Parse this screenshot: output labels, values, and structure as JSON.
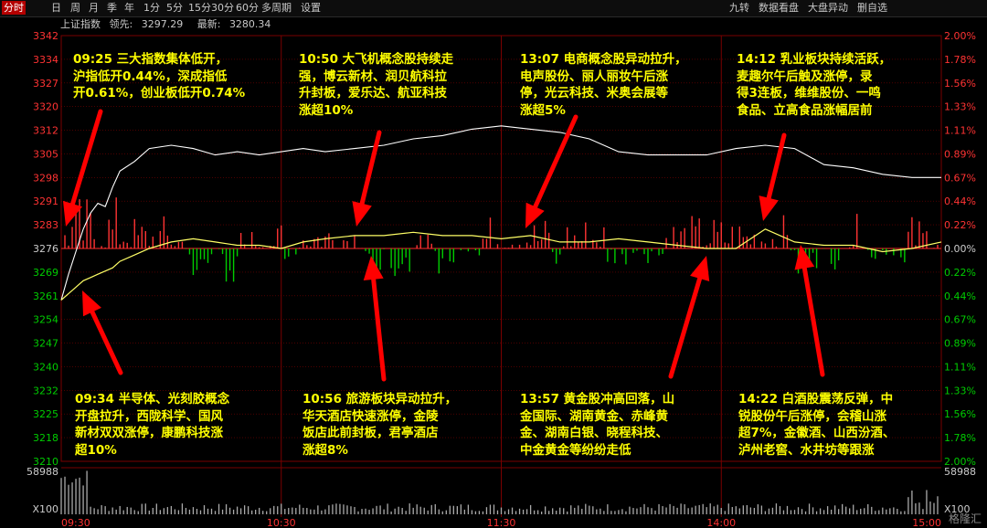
{
  "toolbar": {
    "left": [
      "分时",
      "日",
      "周",
      "月",
      "季",
      "年",
      "1分",
      "5分",
      "15分",
      "30分",
      "60分",
      "多周期",
      "设置"
    ],
    "active_index": 0,
    "right": [
      "九转",
      "数据看盘",
      "大盘异动",
      "删自选"
    ]
  },
  "info": {
    "name": "上证指数",
    "prev_label": "领先:",
    "prev_value": "3297.29",
    "last_label": "最新:",
    "last_value": "3280.34"
  },
  "watermark": "格隆汇",
  "colors": {
    "up": "#ff3333",
    "down": "#00cc00",
    "index_line": "#ffffff",
    "leading_line": "#ffff66",
    "annotation": "#ffff00",
    "grid": "#7a0000",
    "axis_text": "#ff3333"
  },
  "annotations": [
    {
      "time": "09:25",
      "text": "09:25 三大指数集体低开，\n沪指低开0.44%，深成指低\n开0.61%，创业板低开0.74%"
    },
    {
      "time": "10:50",
      "text": "10:50 大飞机概念股持续走\n强，博云新材、润贝航科拉\n升封板，爱乐达、航亚科技\n涨超10%"
    },
    {
      "time": "13:07",
      "text": "13:07 电商概念股异动拉升，\n电声股份、丽人丽妆午后涨\n停，光云科技、米奥会展等\n涨超5%"
    },
    {
      "time": "14:12",
      "text": "14:12 乳业板块持续活跃，\n麦趣尔午后触及涨停，录\n得3连板，维维股份、一鸣\n食品、立高食品涨幅居前"
    },
    {
      "time": "09:34",
      "text": "09:34 半导体、光刻胶概念\n开盘拉升，西陇科学、国风\n新材双双涨停，康鹏科技涨\n超10%"
    },
    {
      "time": "10:56",
      "text": "10:56 旅游板块异动拉升，\n华天酒店快速涨停，金陵\n饭店此前封板，君亭酒店\n涨超8%"
    },
    {
      "time": "13:57",
      "text": "13:57 黄金股冲高回落，山\n金国际、湖南黄金、赤峰黄\n金、湖南白银、晓程科技、\n中金黄金等纷纷走低"
    },
    {
      "time": "14:22",
      "text": "14:22 白酒股震荡反弹，中\n锐股份午后涨停，会稽山涨\n超7%，金徽酒、山西汾酒、\n泸州老窖、水井坊等跟涨"
    }
  ],
  "chart_data": {
    "type": "line",
    "title": "上证指数",
    "x_ticks": [
      "09:30",
      "10:30",
      "11:30",
      "14:00",
      "15:00"
    ],
    "y_left_ticks": [
      "3342",
      "3334",
      "3327",
      "3320",
      "3312",
      "3305",
      "3298",
      "3291",
      "3283",
      "3276",
      "3269",
      "3261",
      "3254",
      "3247",
      "3240",
      "3232",
      "3225",
      "3218",
      "3210"
    ],
    "y_right_ticks": [
      "2.00%",
      "1.78%",
      "1.56%",
      "1.33%",
      "1.11%",
      "0.89%",
      "0.67%",
      "0.44%",
      "0.22%",
      "0.00%",
      "0.22%",
      "0.44%",
      "0.67%",
      "0.89%",
      "1.11%",
      "1.33%",
      "1.56%",
      "1.78%",
      "2.00%"
    ],
    "base": 3276,
    "ylim": [
      3210,
      3342
    ],
    "volume_label": "58988",
    "volume_unit": "X100",
    "series": [
      {
        "x": [
          0,
          2,
          4,
          6,
          8,
          10,
          12,
          14,
          16,
          20,
          24,
          30,
          36,
          42,
          48,
          54,
          60,
          66,
          72,
          80,
          88,
          96,
          104,
          112,
          120,
          128,
          136,
          144,
          152,
          160,
          168,
          176,
          184,
          192,
          200,
          208,
          216,
          224,
          232,
          240
        ],
        "values": [
          3260,
          3268,
          3275,
          3282,
          3287,
          3290,
          3289,
          3295,
          3300,
          3303,
          3307,
          3308,
          3307,
          3305,
          3306,
          3305,
          3306,
          3307,
          3306,
          3307,
          3308,
          3310,
          3311,
          3313,
          3314,
          3313,
          3312,
          3310,
          3306,
          3305,
          3305,
          3305,
          3307,
          3308,
          3307,
          3302,
          3301,
          3299,
          3298,
          3298
        ]
      },
      {
        "x": [
          0,
          2,
          4,
          6,
          8,
          10,
          12,
          14,
          16,
          20,
          24,
          30,
          36,
          42,
          48,
          54,
          60,
          66,
          72,
          80,
          88,
          96,
          104,
          112,
          120,
          128,
          136,
          144,
          152,
          160,
          168,
          176,
          184,
          192,
          200,
          208,
          216,
          224,
          232,
          240
        ],
        "values": [
          3260,
          3262,
          3264,
          3266,
          3267,
          3268,
          3269,
          3270,
          3272,
          3274,
          3276,
          3278,
          3279,
          3278,
          3277,
          3277,
          3276,
          3278,
          3279,
          3280,
          3280,
          3281,
          3280,
          3280,
          3279,
          3280,
          3278,
          3278,
          3279,
          3278,
          3277,
          3276,
          3276,
          3282,
          3278,
          3277,
          3277,
          3275,
          3276,
          3278
        ]
      }
    ]
  }
}
